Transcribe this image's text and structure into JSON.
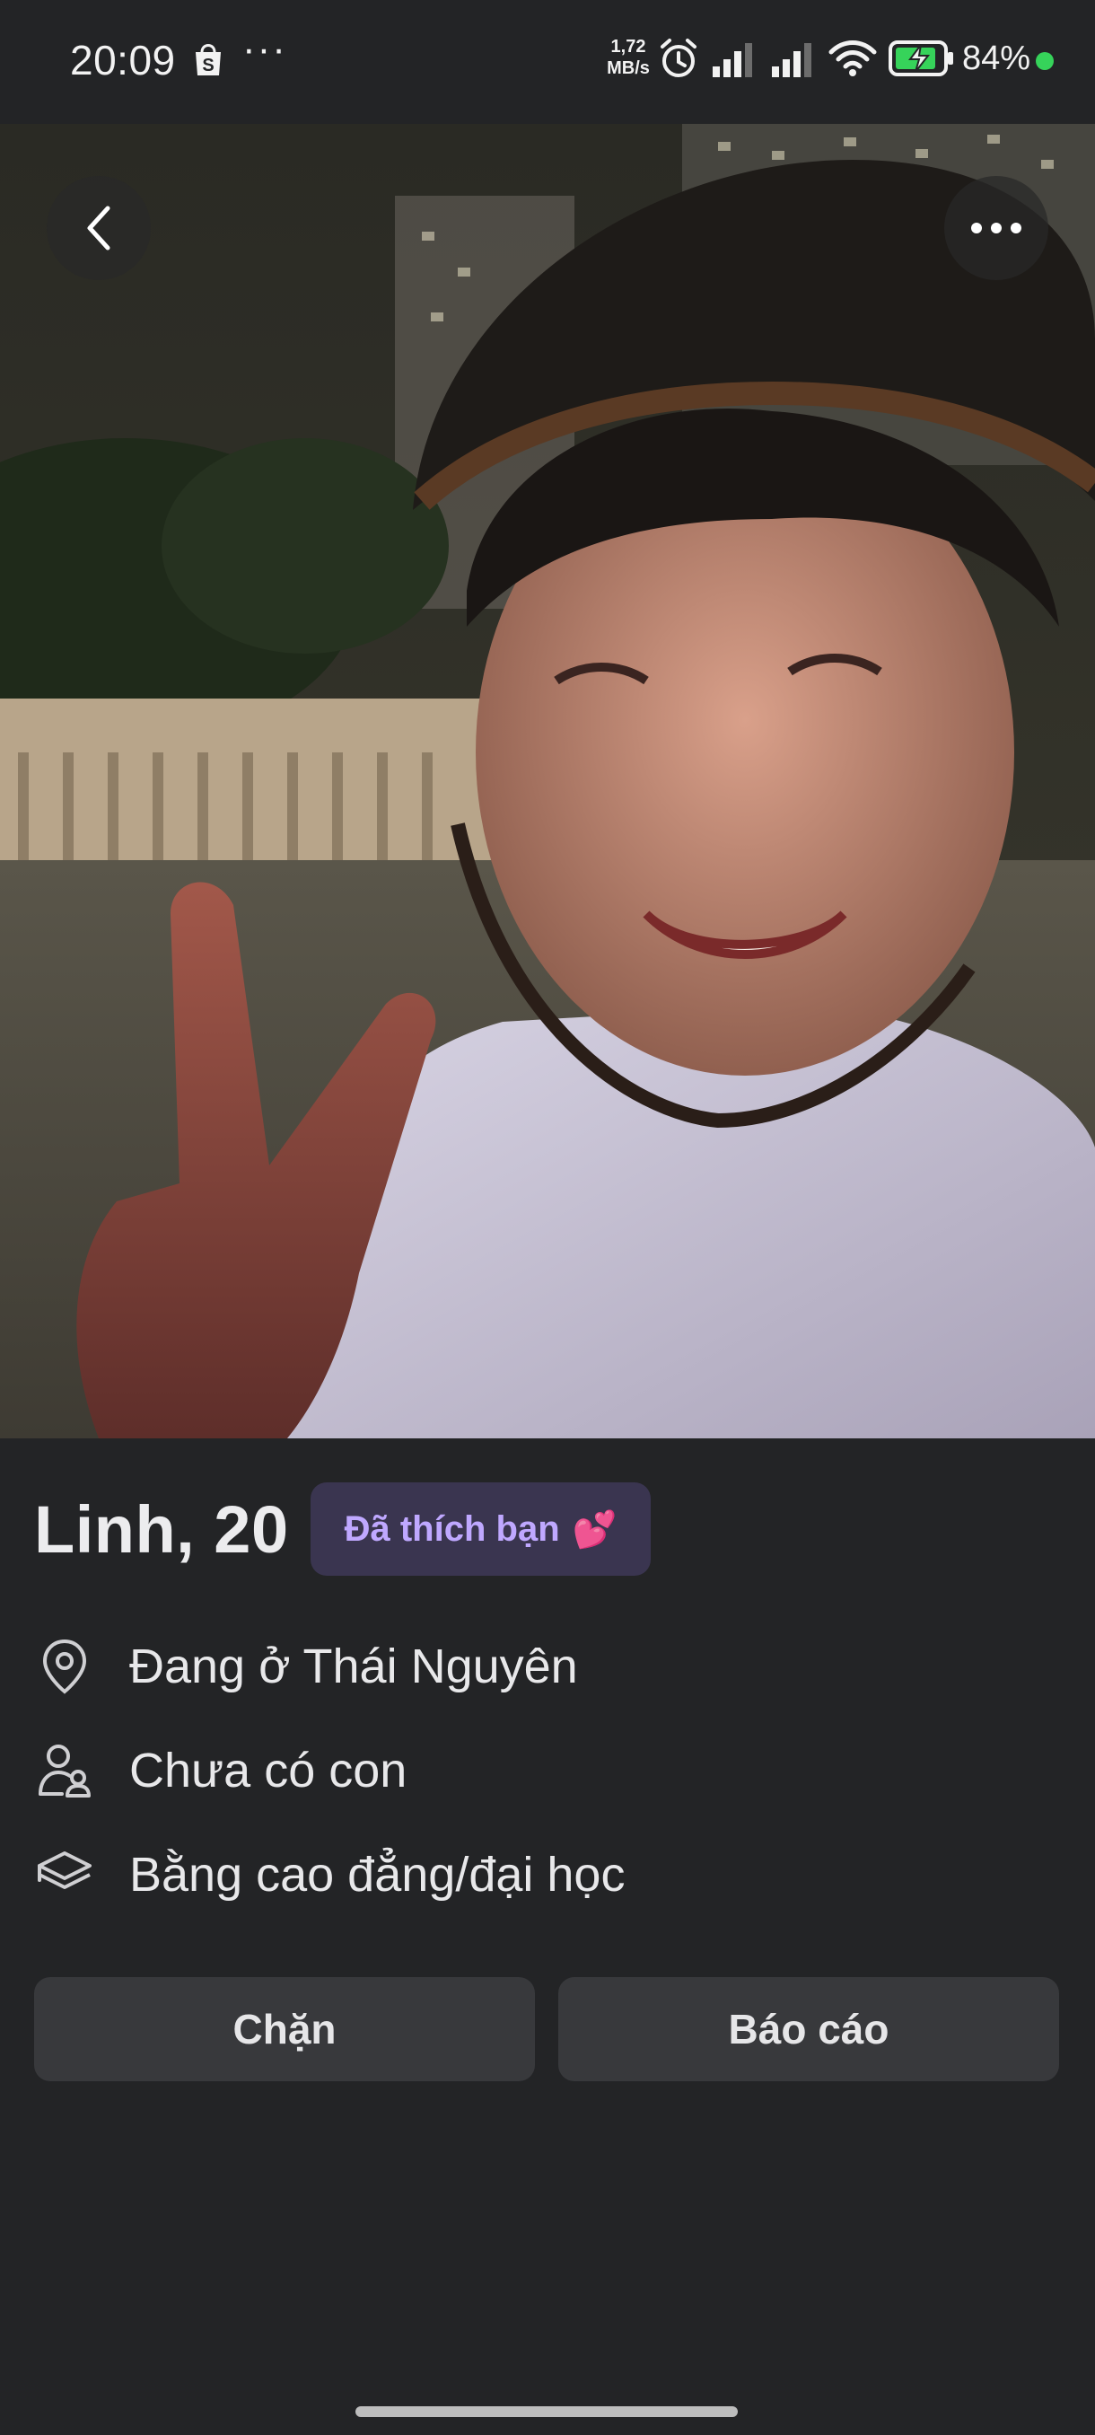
{
  "status_bar": {
    "time": "20:09",
    "more": "···",
    "net_speed_value": "1,72",
    "net_speed_unit": "MB/s",
    "battery_percent": "84%",
    "icons": [
      "shopping-bag-icon",
      "alarm-icon",
      "signal-icon",
      "signal-icon",
      "wifi-icon",
      "battery-charging-icon"
    ]
  },
  "photo": {
    "description_icon": "profile-photo"
  },
  "profile": {
    "name_age": "Linh, 20",
    "badge_label": "Đã thích bạn",
    "badge_emoji": "💕",
    "details": [
      {
        "icon": "location-pin-icon",
        "text": "Đang ở Thái Nguyên"
      },
      {
        "icon": "person-child-icon",
        "text": "Chưa có con"
      },
      {
        "icon": "graduation-cap-icon",
        "text": "Bằng cao đẳng/đại học"
      }
    ]
  },
  "actions": {
    "block_label": "Chặn",
    "report_label": "Báo cáo"
  },
  "colors": {
    "background": "#232426",
    "badge_bg": "#3a3550",
    "badge_text": "#bfa8ff",
    "button_bg": "#38393c",
    "status_dot": "#36d35a"
  }
}
